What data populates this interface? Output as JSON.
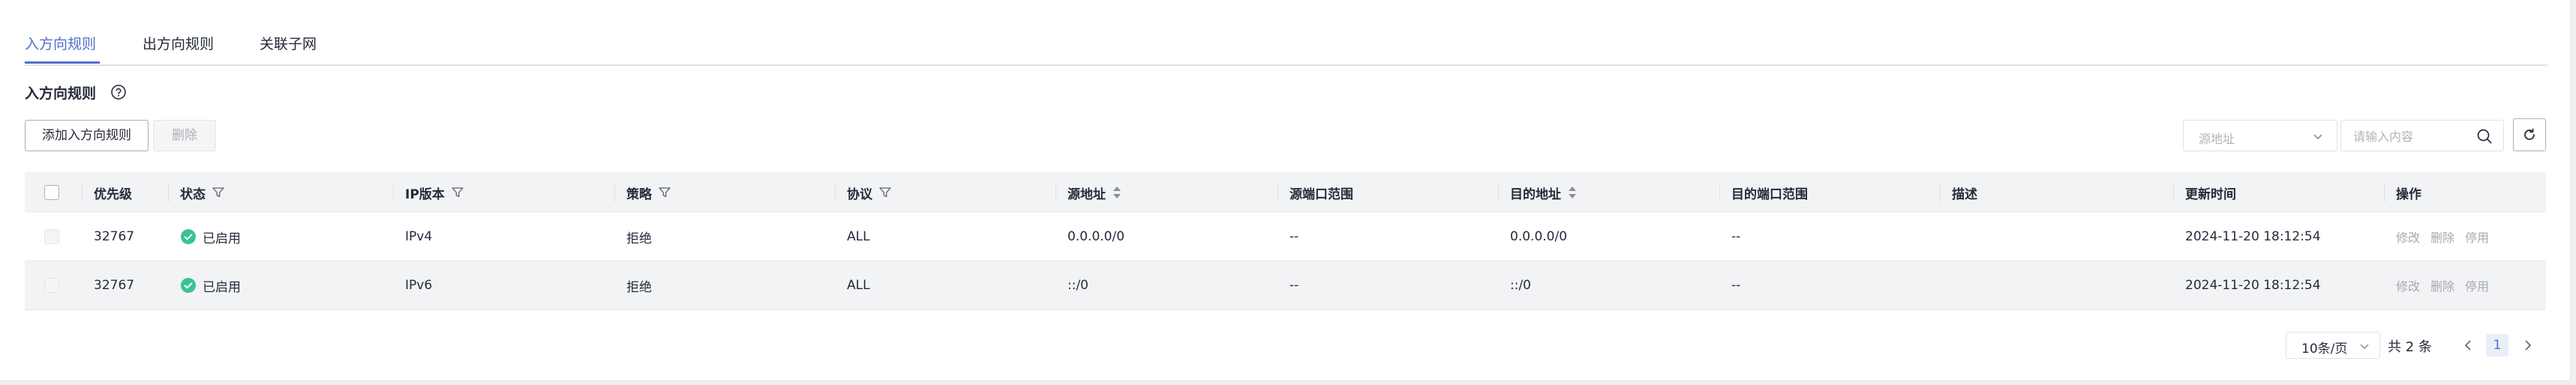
{
  "tabs": [
    {
      "label": "入方向规则",
      "active": true
    },
    {
      "label": "出方向规则",
      "active": false
    },
    {
      "label": "关联子网",
      "active": false
    }
  ],
  "section": {
    "title": "入方向规则",
    "help_icon": "question-circle-icon"
  },
  "toolbar": {
    "add_label": "添加入方向规则",
    "delete_label": "删除",
    "select_placeholder": "源地址",
    "search_placeholder": "请输入内容",
    "refresh_icon": "refresh-icon"
  },
  "table": {
    "headers": {
      "priority": "优先级",
      "status": "状态",
      "ip_version": "IP版本",
      "policy": "策略",
      "protocol": "协议",
      "source": "源地址",
      "source_port": "源端口范围",
      "dest": "目的地址",
      "dest_port": "目的端口范围",
      "desc": "描述",
      "updated": "更新时间",
      "ops": "操作"
    },
    "rows": [
      {
        "priority": "32767",
        "status": "已启用",
        "ip_version": "IPv4",
        "policy": "拒绝",
        "protocol": "ALL",
        "source": "0.0.0.0/0",
        "source_port": "--",
        "dest": "0.0.0.0/0",
        "dest_port": "--",
        "desc": "",
        "updated": "2024-11-20 18:12:54",
        "op_edit": "修改",
        "op_delete": "删除",
        "op_disable": "停用"
      },
      {
        "priority": "32767",
        "status": "已启用",
        "ip_version": "IPv6",
        "policy": "拒绝",
        "protocol": "ALL",
        "source": "::/0",
        "source_port": "--",
        "dest": "::/0",
        "dest_port": "--",
        "desc": "",
        "updated": "2024-11-20 18:12:54",
        "op_edit": "修改",
        "op_delete": "删除",
        "op_disable": "停用"
      }
    ]
  },
  "pagination": {
    "page_size": "10条/页",
    "total": "共 2 条",
    "current_page": "1"
  },
  "colors": {
    "accent": "#526ecc",
    "success": "#3ac295",
    "header_bg": "#f2f3f5"
  }
}
